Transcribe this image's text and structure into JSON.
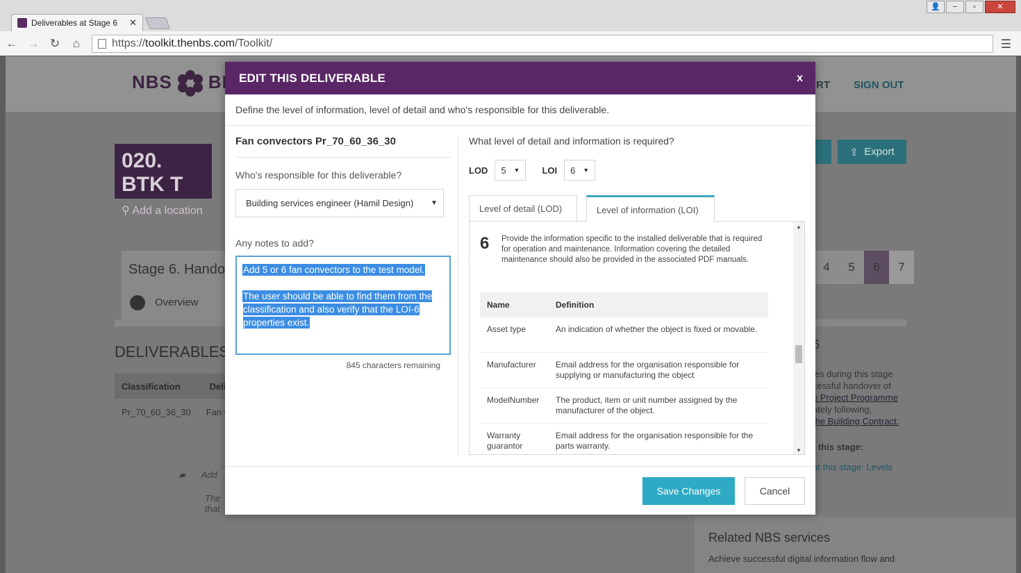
{
  "browser": {
    "tab_title": "Deliverables at Stage 6",
    "tab_close": "✕",
    "url_scheme": "https://",
    "url_host": "toolkit.thenbs.com",
    "url_path": "/Toolkit/",
    "window_buttons": {
      "minimize": "−",
      "maximize": "▫",
      "close": "✕",
      "user": "👤"
    }
  },
  "background": {
    "logo_text_left": "NBS",
    "logo_text_right": "BIM",
    "nav_partial": "RT",
    "sign_out": "SIGN OUT",
    "project_title": "020. BTK T",
    "add_location": "Add a location",
    "export": "Export",
    "stage_title": "Stage 6. Hando",
    "overview": "Overview",
    "stage_numbers": [
      "4",
      "5",
      "6",
      "7"
    ],
    "active_stage": "6",
    "deliverables_heading": "DELIVERABLES A",
    "col_classification": "Classification",
    "col_deliv": "Deliv",
    "row_classification": "Pr_70_60_36_30",
    "row_deliv": "Fan c",
    "comment_1": "Add",
    "comment_2": "The",
    "comment_3": "that",
    "right_lines": [
      "ies during this stage",
      "cessful handover of",
      "e Project Programme",
      "ately following,",
      "the Building Contract."
    ],
    "right_bold": "t this stage:",
    "right_link": "at this stage: Levels",
    "right_num": "6",
    "related_heading": "Related NBS services",
    "related_text": "Achieve successful digital information flow and"
  },
  "modal": {
    "title": "EDIT THIS DELIVERABLE",
    "close": "x",
    "subtitle": "Define the level of information, level of detail and who's responsible for this deliverable.",
    "deliverable_name": "Fan convectors Pr_70_60_36_30",
    "responsible_question": "Who's responsible for this deliverable?",
    "responsible_value": "Building services engineer (Hamil Design)",
    "notes_question": "Any notes to add?",
    "notes_line1": "Add 5 or 6 fan convectors to the test model.",
    "notes_line2": "The user should be able to find them from the classification and also verify that the LOI-6 properties exist.",
    "chars_remaining": "845 characters remaining",
    "level_question": "What level of detail and information is required?",
    "lod_label": "LOD",
    "lod_value": "5",
    "loi_label": "LOI",
    "loi_value": "6",
    "tab_lod": "Level of detail (LOD)",
    "tab_loi": "Level of information (LOI)",
    "active_tab": "Level of information (LOI)",
    "level_number": "6",
    "level_description": "Provide the information specific to the installed deliverable that is required for operation and maintenance. Information covering the detailed maintenance should also be provided in the associated PDF manuals.",
    "table_headers": [
      "Name",
      "Definition"
    ],
    "table_rows": [
      {
        "name": "Asset type",
        "definition": "An indication of whether the object is fixed or movable."
      },
      {
        "name": "Manufacturer",
        "definition": "Email address for the organisation responsible for supplying or manufacturing the object"
      },
      {
        "name": "ModelNumber",
        "definition": "The product, item or unit number assigned by the manufacturer of the object."
      },
      {
        "name": "Warranty guarantor",
        "definition": "Email address for the organisation responsible for the parts warranty."
      }
    ],
    "save": "Save Changes",
    "cancel": "Cancel"
  }
}
